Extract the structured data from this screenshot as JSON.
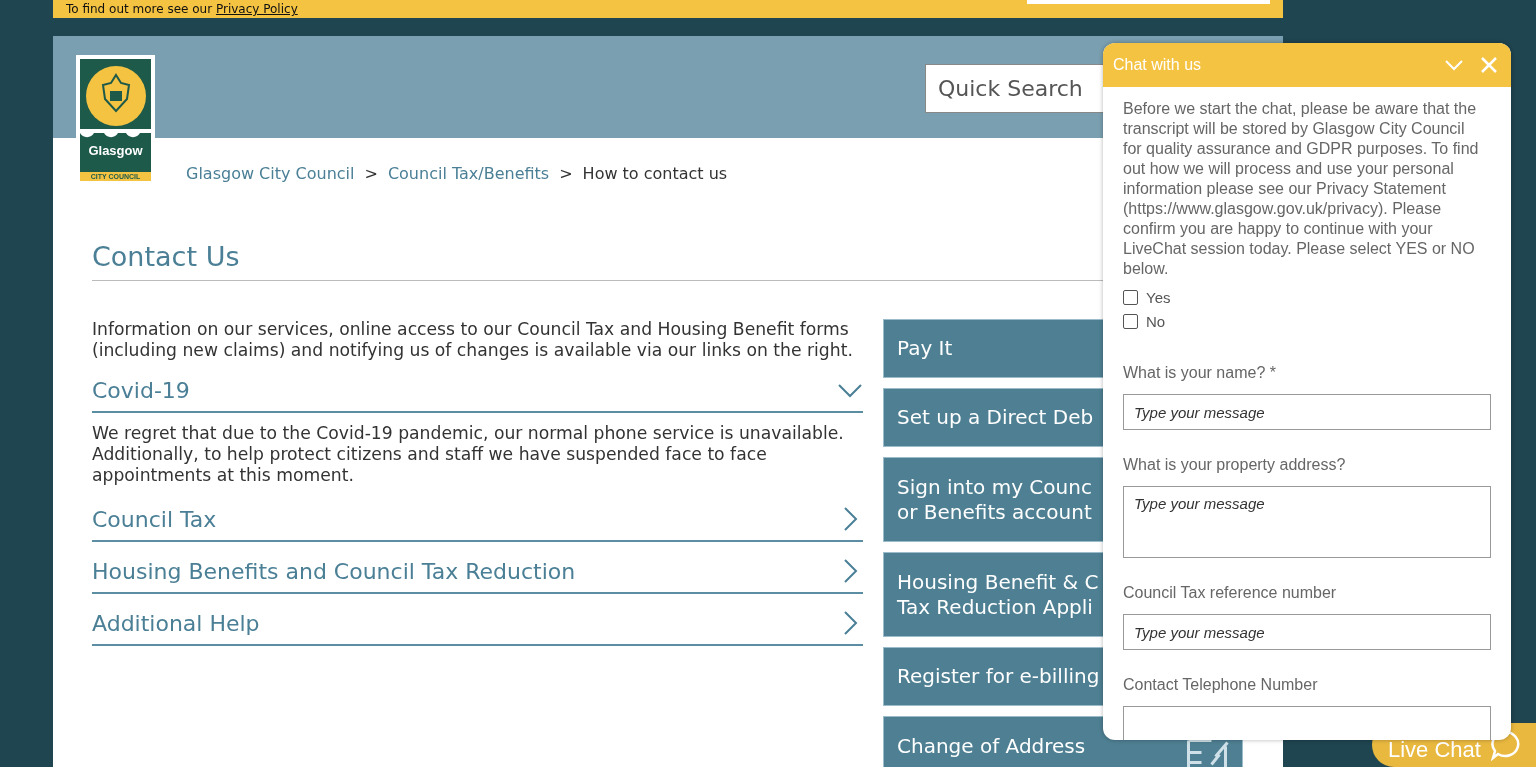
{
  "cookie_banner": {
    "text": "To find out more see our",
    "link": "Privacy Policy"
  },
  "header": {
    "logo": {
      "name": "Glasgow",
      "subtitle": "CITY COUNCIL"
    },
    "search": {
      "placeholder": "Quick Search"
    }
  },
  "breadcrumb": {
    "separator": ">",
    "items": [
      {
        "label": "Glasgow City Council",
        "link": true
      },
      {
        "label": "Council Tax/Benefits",
        "link": true
      },
      {
        "label": "How to contact us",
        "link": false
      }
    ]
  },
  "page_title": "Contact Us",
  "intro": "Information on our services, online access to our Council Tax and Housing Benefit forms (including new claims) and notifying us of changes is available via our links on the right.",
  "sections": [
    {
      "title": "Covid-19",
      "expanded": true,
      "body": "We regret that due to the Covid-19 pandemic, our normal phone service is unavailable. Additionally, to help protect citizens and staff we have suspended face to face appointments at this moment."
    },
    {
      "title": "Council Tax",
      "expanded": false
    },
    {
      "title": "Housing Benefits and Council Tax Reduction",
      "expanded": false
    },
    {
      "title": "Additional Help",
      "expanded": false
    }
  ],
  "quick_links": [
    {
      "lines": [
        "Pay It"
      ]
    },
    {
      "lines": [
        "Set up a Direct Deb"
      ]
    },
    {
      "lines": [
        "Sign into my Counc",
        "or Benefits account"
      ]
    },
    {
      "lines": [
        "Housing Benefit & C",
        "Tax Reduction Appli"
      ]
    },
    {
      "lines": [
        "Register for e-billing"
      ]
    },
    {
      "lines": [
        "Change of Address"
      ],
      "icon": true
    }
  ],
  "chat": {
    "title": "Chat with us",
    "notice": "Before we start the chat, please be aware that the transcript will be stored by Glasgow City Council for quality assurance and GDPR purposes. To find out how we will process and use your personal information please see our Privacy Statement (https://www.glasgow.gov.uk/privacy). Please confirm you are happy to continue with your LiveChat session today. Please select YES or NO below.",
    "options": [
      {
        "label": "Yes",
        "checked": false
      },
      {
        "label": "No",
        "checked": false
      }
    ],
    "fields": [
      {
        "label": "What is your name? *",
        "placeholder": "Type your message",
        "kind": "text"
      },
      {
        "label": "What is your property address?",
        "placeholder": "Type your message",
        "kind": "textarea"
      },
      {
        "label": "Council Tax reference number",
        "placeholder": "Type your message",
        "kind": "text"
      },
      {
        "label": "Contact Telephone Number",
        "kind": "text"
      }
    ]
  },
  "live_chat_button": "Live Chat"
}
